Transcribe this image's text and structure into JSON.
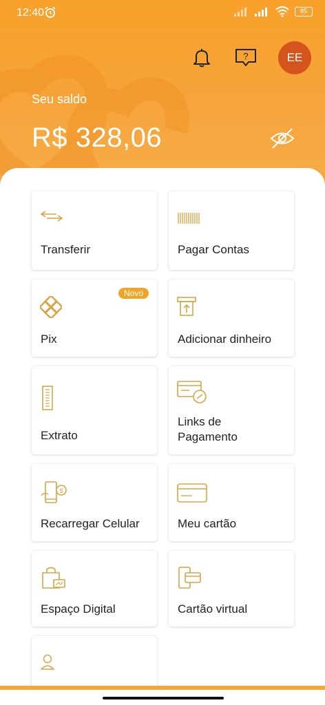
{
  "status": {
    "time": "12:40",
    "battery": "85"
  },
  "balance": {
    "label": "Seu saldo",
    "value": "R$ 328,06"
  },
  "avatar_initials": "EE",
  "colors": {
    "accent": "#f6a43a",
    "icon": "#d9a444",
    "avatar": "#d5531c",
    "badge": "#f0a524"
  },
  "cards": [
    {
      "label": "Transferir",
      "icon": "transfer-icon"
    },
    {
      "label": "Pagar Contas",
      "icon": "barcode-icon"
    },
    {
      "label": "Pix",
      "icon": "pix-icon",
      "badge": "Novo"
    },
    {
      "label": "Adicionar dinheiro",
      "icon": "add-money-icon"
    },
    {
      "label": "Extrato",
      "icon": "statement-icon"
    },
    {
      "label": "Links de\nPagamento",
      "icon": "payment-link-icon"
    },
    {
      "label": "Recarregar Celular",
      "icon": "phone-recharge-icon"
    },
    {
      "label": "Meu cartão",
      "icon": "card-icon"
    },
    {
      "label": "Espaço Digital",
      "icon": "digital-space-icon"
    },
    {
      "label": "Cartão virtual",
      "icon": "virtual-card-icon"
    },
    {
      "label": "",
      "icon": "user-icon"
    }
  ]
}
